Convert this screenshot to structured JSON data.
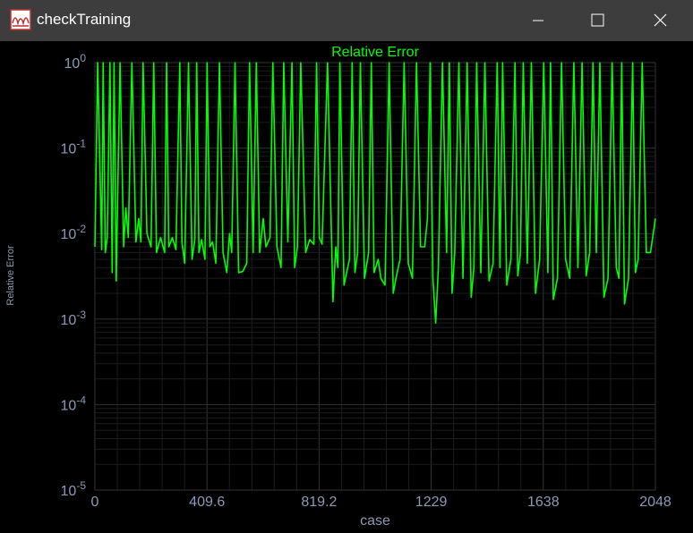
{
  "window": {
    "title": "checkTraining",
    "app_icon": "chart-app-icon",
    "controls": [
      "minimize-icon",
      "maximize-icon",
      "close-icon"
    ]
  },
  "colors": {
    "background": "#000000",
    "series": "#00ff00",
    "axis_text": "#8a9bb5",
    "grid": "#2a2a2a",
    "titlebar": "#3d3d3d"
  },
  "chart_data": {
    "type": "line",
    "title": "Relative Error",
    "xlabel": "case",
    "ylabel": "Relative Error",
    "xscale": "linear",
    "yscale": "log",
    "xlim": [
      0,
      2048
    ],
    "ylim": [
      1e-05,
      1
    ],
    "xticks": [
      "0",
      "409.6",
      "819.2",
      "1229",
      "1638",
      "2048"
    ],
    "yticks": [
      {
        "base": "10",
        "exp": "0"
      },
      {
        "base": "10",
        "exp": "-1"
      },
      {
        "base": "10",
        "exp": "-2"
      },
      {
        "base": "10",
        "exp": "-3"
      },
      {
        "base": "10",
        "exp": "-4"
      },
      {
        "base": "10",
        "exp": "-5"
      }
    ],
    "grid": true,
    "series": [
      {
        "color": "#00ff00",
        "x": [
          0,
          10,
          25,
          30,
          38,
          45,
          55,
          63,
          70,
          78,
          92,
          105,
          113,
          122,
          135,
          150,
          160,
          168,
          176,
          190,
          205,
          215,
          225,
          240,
          255,
          262,
          270,
          283,
          296,
          310,
          318,
          328,
          342,
          355,
          365,
          372,
          380,
          390,
          402,
          410,
          420,
          430,
          442,
          455,
          468,
          482,
          492,
          500,
          512,
          525,
          540,
          555,
          565,
          578,
          590,
          602,
          615,
          625,
          640,
          650,
          665,
          680,
          690,
          705,
          720,
          730,
          740,
          752,
          770,
          785,
          800,
          810,
          820,
          830,
          850,
          870,
          880,
          888,
          895,
          910,
          930,
          940,
          950,
          960,
          970,
          985,
          1000,
          1010,
          1020,
          1035,
          1045,
          1060,
          1075,
          1090,
          1100,
          1115,
          1130,
          1145,
          1160,
          1175,
          1190,
          1205,
          1215,
          1225,
          1235,
          1245,
          1255,
          1270,
          1285,
          1295,
          1305,
          1315,
          1330,
          1345,
          1360,
          1375,
          1385,
          1395,
          1410,
          1425,
          1440,
          1455,
          1470,
          1480,
          1490,
          1505,
          1520,
          1535,
          1545,
          1555,
          1565,
          1580,
          1595,
          1610,
          1625,
          1640,
          1655,
          1665,
          1675,
          1690,
          1705,
          1720,
          1735,
          1750,
          1765,
          1780,
          1795,
          1808,
          1820,
          1832,
          1845,
          1860,
          1875,
          1890,
          1905,
          1915,
          1925,
          1935,
          1950,
          1965,
          1975,
          1985,
          2000,
          2015,
          2030,
          2048
        ],
        "y": [
          0.007,
          1,
          0.0065,
          1,
          0.006,
          0.009,
          1,
          0.0035,
          1,
          0.0028,
          1,
          0.007,
          0.02,
          0.009,
          1,
          0.008,
          0.015,
          0.008,
          1,
          0.01,
          0.007,
          1,
          0.006,
          0.009,
          0.006,
          1,
          0.007,
          0.009,
          0.0065,
          1,
          0.008,
          0.0045,
          1,
          0.005,
          0.0085,
          1,
          0.006,
          0.0085,
          0.005,
          1,
          0.007,
          0.008,
          0.0045,
          1,
          0.006,
          0.0035,
          0.01,
          0.006,
          1,
          0.0035,
          0.0036,
          0.0045,
          1,
          0.006,
          1,
          0.006,
          0.015,
          0.007,
          0.009,
          1,
          0.007,
          0.004,
          1,
          0.008,
          1,
          0.004,
          0.007,
          1,
          0.006,
          0.0085,
          0.0075,
          1,
          0.009,
          0.0075,
          1,
          0.0016,
          0.007,
          0.004,
          1,
          0.0025,
          0.005,
          1,
          0.0035,
          0.006,
          1,
          0.003,
          0.006,
          1,
          0.0035,
          0.005,
          0.003,
          0.0025,
          1,
          0.002,
          0.003,
          0.005,
          1,
          0.0045,
          0.003,
          1,
          0.007,
          0.007,
          0.015,
          1,
          0.003,
          0.0009,
          0.004,
          1,
          0.006,
          1,
          0.002,
          0.006,
          1,
          0.003,
          1,
          0.0018,
          0.004,
          1,
          0.0035,
          1,
          0.0028,
          0.0045,
          1,
          0.004,
          1,
          0.0025,
          0.005,
          1,
          0.0032,
          0.006,
          1,
          0.0045,
          1,
          0.002,
          0.005,
          1,
          0.0035,
          1,
          0.0017,
          0.003,
          1,
          0.005,
          0.003,
          1,
          0.004,
          1,
          0.0032,
          0.006,
          1,
          0.006,
          1,
          0.0018,
          0.003,
          1,
          0.004,
          0.003,
          1,
          0.0015,
          0.003,
          1,
          0.0035,
          0.005,
          1,
          0.006,
          0.006,
          0.015
        ]
      }
    ]
  }
}
